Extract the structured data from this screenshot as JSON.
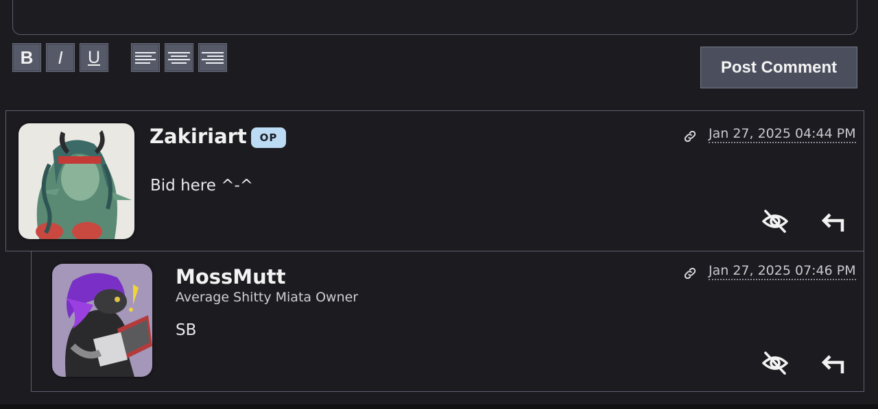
{
  "editor": {
    "format_buttons": {
      "bold": "B",
      "italic": "I",
      "underline": "U"
    },
    "post_button_label": "Post Comment"
  },
  "comments": [
    {
      "username": "Zakiriart",
      "badge": "OP",
      "body": "Bid here ^-^",
      "timestamp": "Jan 27, 2025 04:44 PM",
      "avatar": "avatar-zakiriart"
    },
    {
      "username": "MossMutt",
      "subtitle": "Average Shitty Miata Owner",
      "body": "SB",
      "timestamp": "Jan 27, 2025 07:46 PM",
      "avatar": "avatar-mossmutt"
    }
  ],
  "icons": {
    "permalink": "link-icon",
    "hide": "eye-off-icon",
    "reply": "reply-arrow-icon"
  },
  "colors": {
    "background": "#1c1b20",
    "button": "#4b4f5d",
    "op_badge": "#bcdbf4"
  }
}
